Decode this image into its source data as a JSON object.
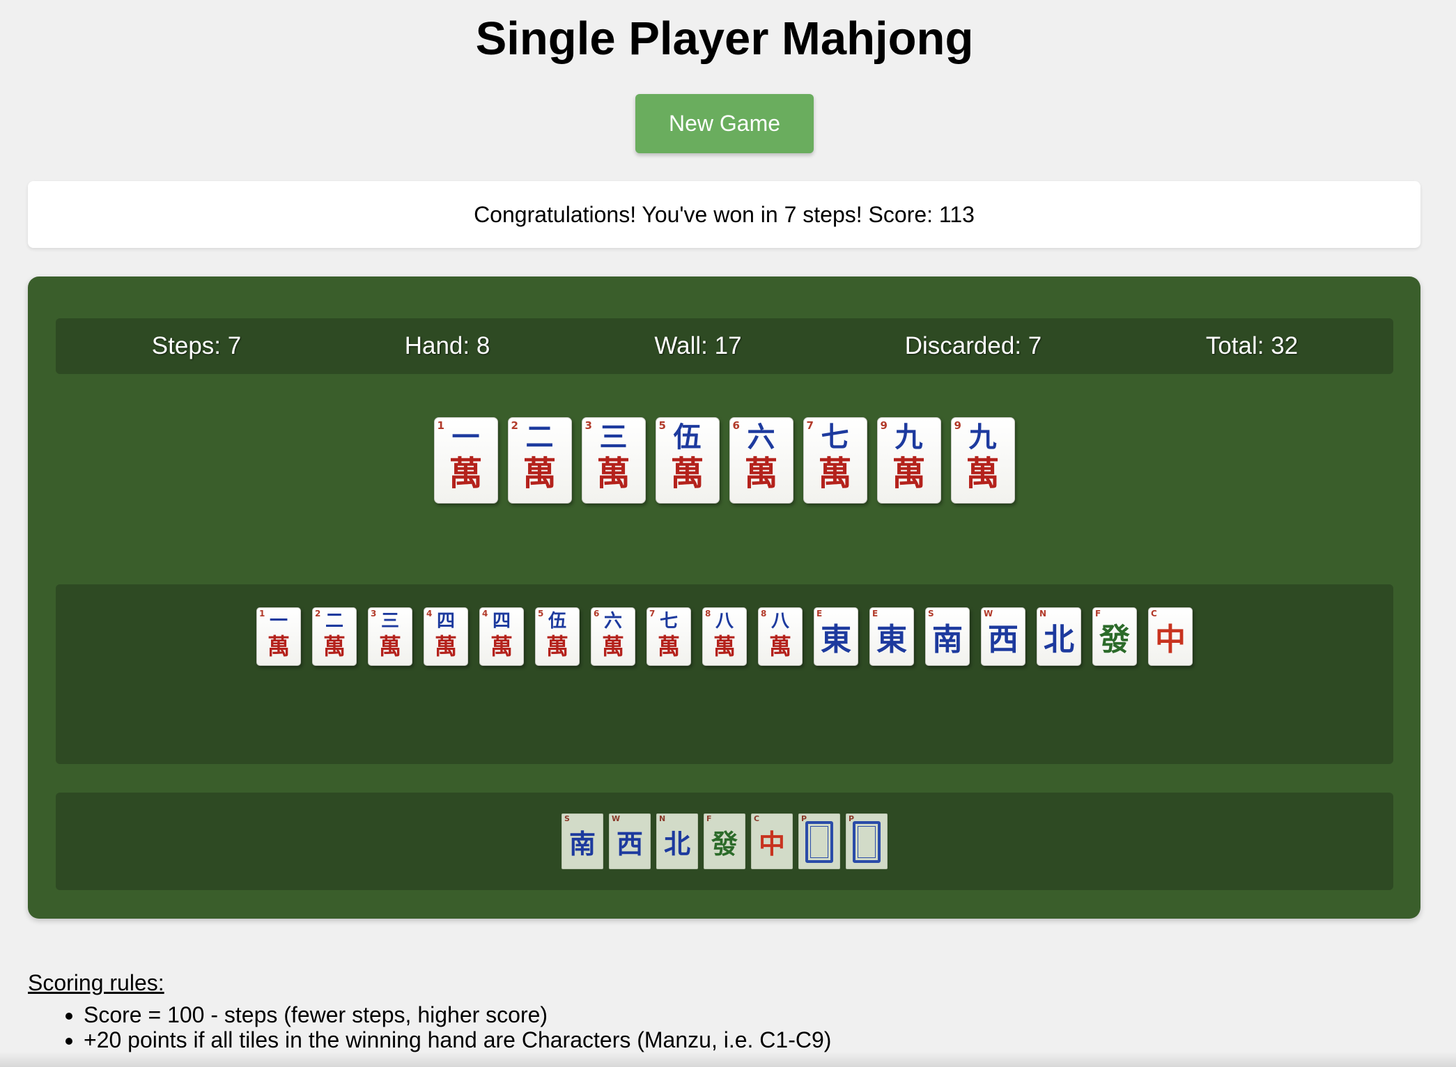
{
  "title": "Single Player Mahjong",
  "new_game_label": "New Game",
  "message": "Congratulations! You've won in 7 steps! Score: 113",
  "stats": {
    "steps": "Steps: 7",
    "hand": "Hand: 8",
    "wall": "Wall: 17",
    "discarded": "Discarded: 7",
    "total": "Total: 32"
  },
  "hand_tiles": [
    {
      "corner": "1",
      "glyph": "一",
      "suit": "萬",
      "icon": "character-1-tile"
    },
    {
      "corner": "2",
      "glyph": "二",
      "suit": "萬",
      "icon": "character-2-tile"
    },
    {
      "corner": "3",
      "glyph": "三",
      "suit": "萬",
      "icon": "character-3-tile"
    },
    {
      "corner": "5",
      "glyph": "伍",
      "suit": "萬",
      "icon": "character-5-tile"
    },
    {
      "corner": "6",
      "glyph": "六",
      "suit": "萬",
      "icon": "character-6-tile"
    },
    {
      "corner": "7",
      "glyph": "七",
      "suit": "萬",
      "icon": "character-7-tile"
    },
    {
      "corner": "9",
      "glyph": "九",
      "suit": "萬",
      "icon": "character-9-tile"
    },
    {
      "corner": "9",
      "glyph": "九",
      "suit": "萬",
      "icon": "character-9-tile"
    }
  ],
  "wall_tiles": [
    {
      "corner": "1",
      "glyph": "一",
      "suit": "萬",
      "icon": "character-1-tile"
    },
    {
      "corner": "2",
      "glyph": "二",
      "suit": "萬",
      "icon": "character-2-tile"
    },
    {
      "corner": "3",
      "glyph": "三",
      "suit": "萬",
      "icon": "character-3-tile"
    },
    {
      "corner": "4",
      "glyph": "四",
      "suit": "萬",
      "icon": "character-4-tile"
    },
    {
      "corner": "4",
      "glyph": "四",
      "suit": "萬",
      "icon": "character-4-tile"
    },
    {
      "corner": "5",
      "glyph": "伍",
      "suit": "萬",
      "icon": "character-5-tile"
    },
    {
      "corner": "6",
      "glyph": "六",
      "suit": "萬",
      "icon": "character-6-tile"
    },
    {
      "corner": "7",
      "glyph": "七",
      "suit": "萬",
      "icon": "character-7-tile"
    },
    {
      "corner": "8",
      "glyph": "八",
      "suit": "萬",
      "icon": "character-8-tile"
    },
    {
      "corner": "8",
      "glyph": "八",
      "suit": "萬",
      "icon": "character-8-tile"
    },
    {
      "corner": "E",
      "honor": "東",
      "color": "blue",
      "icon": "east-wind-tile"
    },
    {
      "corner": "E",
      "honor": "東",
      "color": "blue",
      "icon": "east-wind-tile"
    },
    {
      "corner": "S",
      "honor": "南",
      "color": "blue",
      "icon": "south-wind-tile"
    },
    {
      "corner": "W",
      "honor": "西",
      "color": "blue",
      "icon": "west-wind-tile"
    },
    {
      "corner": "N",
      "honor": "北",
      "color": "blue",
      "icon": "north-wind-tile"
    },
    {
      "corner": "F",
      "honor": "發",
      "color": "green",
      "icon": "green-dragon-tile"
    },
    {
      "corner": "C",
      "honor": "中",
      "color": "red",
      "icon": "red-dragon-tile"
    }
  ],
  "discard_tiles": [
    {
      "corner": "S",
      "honor": "南",
      "color": "blue",
      "icon": "south-wind-tile"
    },
    {
      "corner": "W",
      "honor": "西",
      "color": "blue",
      "icon": "west-wind-tile"
    },
    {
      "corner": "N",
      "honor": "北",
      "color": "blue",
      "icon": "north-wind-tile"
    },
    {
      "corner": "F",
      "honor": "發",
      "color": "green",
      "icon": "green-dragon-tile"
    },
    {
      "corner": "C",
      "honor": "中",
      "color": "red",
      "icon": "red-dragon-tile"
    },
    {
      "corner": "P",
      "frame": true,
      "icon": "white-dragon-tile"
    },
    {
      "corner": "P",
      "frame": true,
      "icon": "white-dragon-tile"
    }
  ],
  "scoring": {
    "title": "Scoring rules:",
    "rules": [
      "Score = 100 - steps (fewer steps, higher score)",
      "+20 points if all tiles in the winning hand are Characters (Manzu, i.e. C1-C9)"
    ]
  }
}
